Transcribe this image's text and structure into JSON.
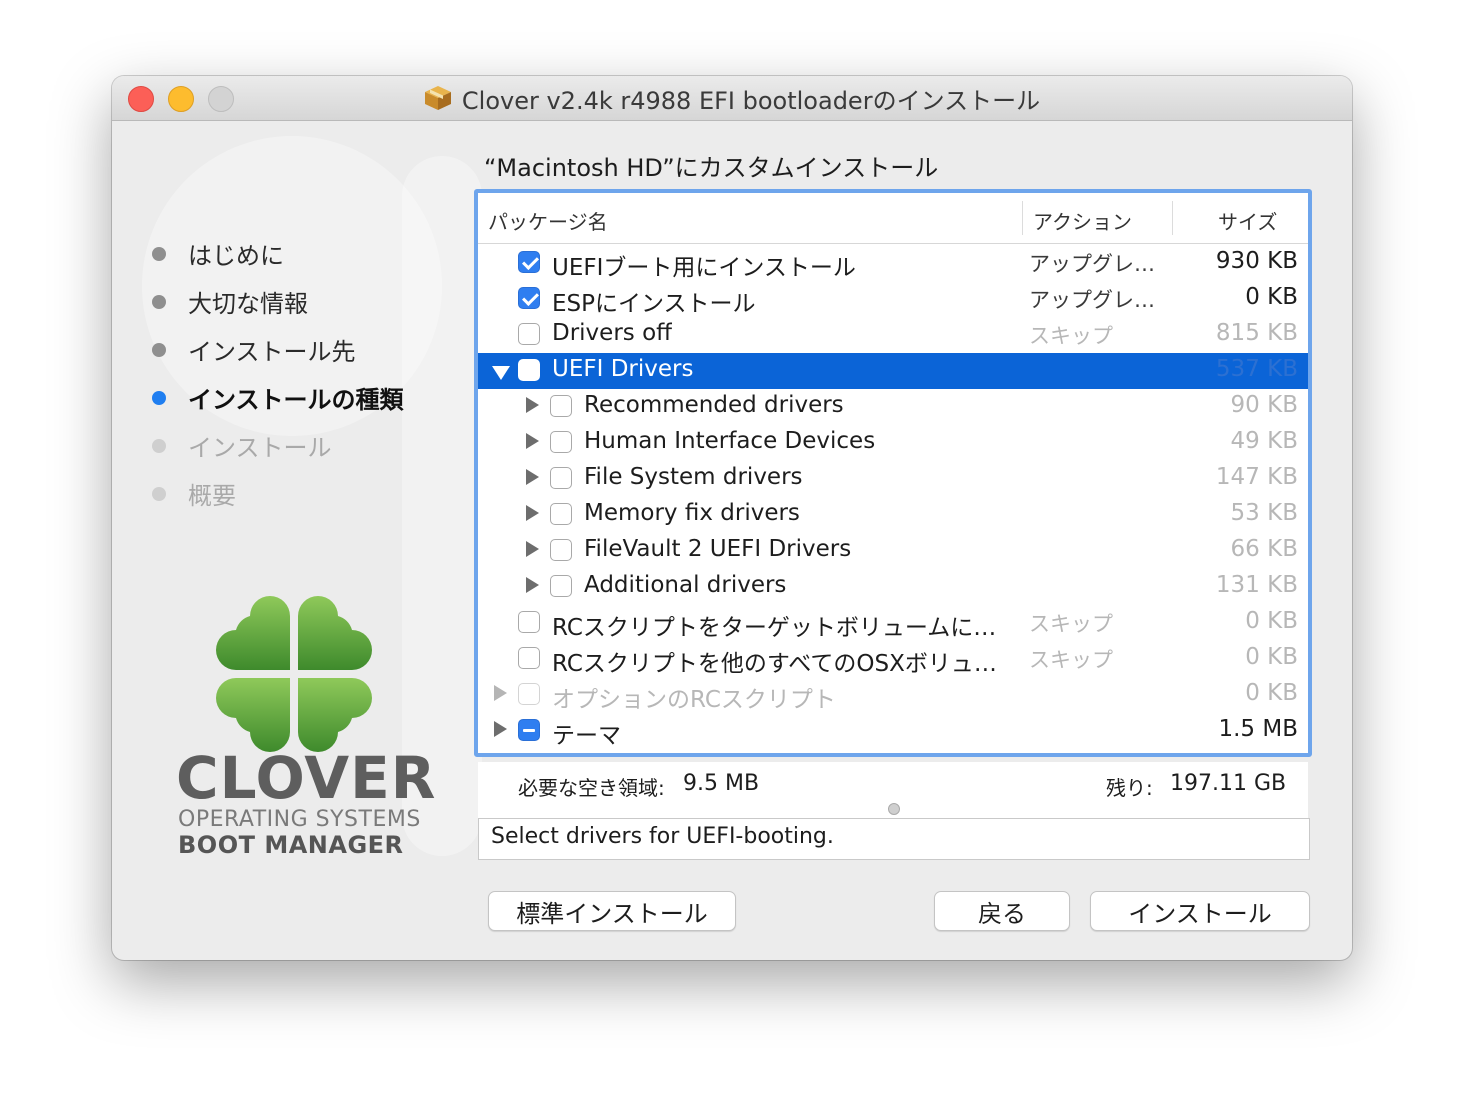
{
  "window": {
    "title": "Clover v2.4k r4988 EFI bootloaderのインストール"
  },
  "sidebar": {
    "steps": [
      {
        "label": "はじめに",
        "state": "done"
      },
      {
        "label": "大切な情報",
        "state": "done"
      },
      {
        "label": "インストール先",
        "state": "done"
      },
      {
        "label": "インストールの種類",
        "state": "active"
      },
      {
        "label": "インストール",
        "state": "future"
      },
      {
        "label": "概要",
        "state": "future"
      }
    ],
    "logo": {
      "word": "CLOVER",
      "line1": "OPERATING SYSTEMS",
      "line2": "BOOT MANAGER",
      "leaf_color": "#5aa83a"
    }
  },
  "main": {
    "heading": "“Macintosh HD”にカスタムインストール",
    "columns": {
      "name": "パッケージ名",
      "action": "アクション",
      "size": "サイズ"
    },
    "rows": [
      {
        "name": "UEFIブート用にインストール",
        "action": "アップグレ…",
        "size": "930 KB",
        "check": "checked"
      },
      {
        "name": "ESPにインストール",
        "action": "アップグレ…",
        "size": "0 KB",
        "check": "checked"
      },
      {
        "name": "Drivers off",
        "action": "スキップ",
        "size": "815 KB",
        "check": "unchecked"
      },
      {
        "name": "UEFI Drivers",
        "action": "",
        "size": "537 KB",
        "check": "unchecked",
        "selected": true,
        "expanded": true
      },
      {
        "name": "Recommended drivers",
        "action": "",
        "size": "90 KB",
        "check": "unchecked"
      },
      {
        "name": "Human Interface Devices",
        "action": "",
        "size": "49 KB",
        "check": "unchecked"
      },
      {
        "name": "File System drivers",
        "action": "",
        "size": "147 KB",
        "check": "unchecked"
      },
      {
        "name": "Memory fix drivers",
        "action": "",
        "size": "53 KB",
        "check": "unchecked"
      },
      {
        "name": "FileVault 2 UEFI Drivers",
        "action": "",
        "size": "66 KB",
        "check": "unchecked"
      },
      {
        "name": "Additional drivers",
        "action": "",
        "size": "131 KB",
        "check": "unchecked"
      },
      {
        "name": "RCスクリプトをターゲットボリュームにインス…",
        "action": "スキップ",
        "size": "0 KB",
        "check": "unchecked"
      },
      {
        "name": "RCスクリプトを他のすべてのOSXボリューム…",
        "action": "スキップ",
        "size": "0 KB",
        "check": "unchecked"
      },
      {
        "name": "オプションのRCスクリプト",
        "action": "",
        "size": "0 KB",
        "check": "disabled"
      },
      {
        "name": "テーマ",
        "action": "",
        "size": "1.5 MB",
        "check": "mixed"
      }
    ],
    "space_required_label": "必要な空き領域:",
    "space_required_value": "9.5 MB",
    "remaining_label": "残り:",
    "remaining_value": "197.11 GB",
    "description": "Select drivers for UEFI-booting."
  },
  "buttons": {
    "standard": "標準インストール",
    "back": "戻る",
    "install": "インストール"
  },
  "colors": {
    "accent": "#1f7ef0",
    "selection": "#0b64d7",
    "focus_ring": "#6ea5ec"
  }
}
